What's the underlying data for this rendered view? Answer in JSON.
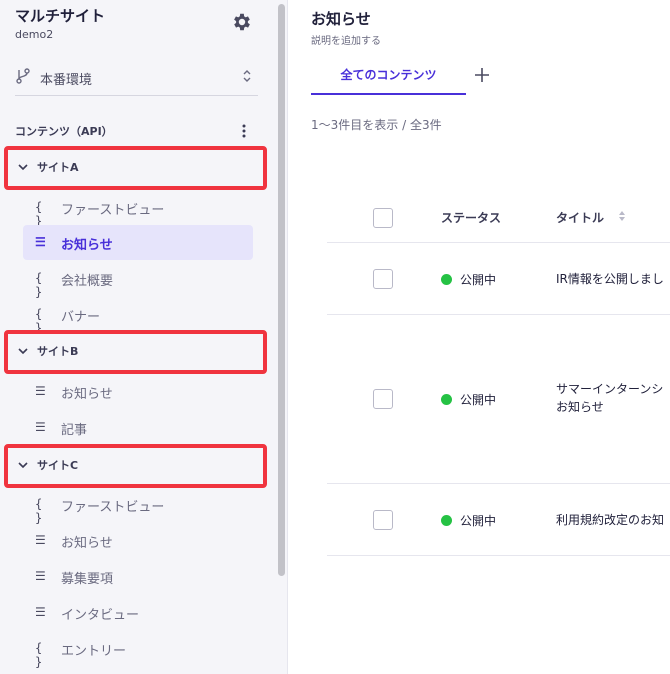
{
  "workspace": {
    "name": "マルチサイト",
    "subtitle": "demo2"
  },
  "environment": {
    "label": "本番環境"
  },
  "sidebar": {
    "section_title": "コンテンツ（API）",
    "groups": [
      {
        "label": "サイトA",
        "items": [
          {
            "icon": "{ }",
            "label": "ファーストビュー"
          },
          {
            "icon": "☰",
            "label": "お知らせ",
            "active": true
          },
          {
            "icon": "{ }",
            "label": "会社概要"
          },
          {
            "icon": "{ }",
            "label": "バナー"
          }
        ]
      },
      {
        "label": "サイトB",
        "items": [
          {
            "icon": "☰",
            "label": "お知らせ"
          },
          {
            "icon": "☰",
            "label": "記事"
          }
        ]
      },
      {
        "label": "サイトC",
        "items": [
          {
            "icon": "{ }",
            "label": "ファーストビュー"
          },
          {
            "icon": "☰",
            "label": "お知らせ"
          },
          {
            "icon": "☰",
            "label": "募集要項"
          },
          {
            "icon": "☰",
            "label": "インタビュー"
          },
          {
            "icon": "{ }",
            "label": "エントリー"
          }
        ]
      }
    ]
  },
  "main": {
    "title": "お知らせ",
    "description": "説明を追加する",
    "tab_label": "全てのコンテンツ",
    "count_text": "1〜3件目を表示 / 全3件",
    "columns": {
      "status": "ステータス",
      "title": "タイトル"
    },
    "rows": [
      {
        "status": "公開中",
        "title_line1": "IR情報を公開しまし",
        "title_line2": ""
      },
      {
        "status": "公開中",
        "title_line1": "サマーインターンシ",
        "title_line2": "お知らせ"
      },
      {
        "status": "公開中",
        "title_line1": "利用規約改定のお知",
        "title_line2": ""
      }
    ]
  },
  "colors": {
    "accent": "#4830d9",
    "highlight_border": "#f0343f",
    "status_published": "#25c244"
  }
}
